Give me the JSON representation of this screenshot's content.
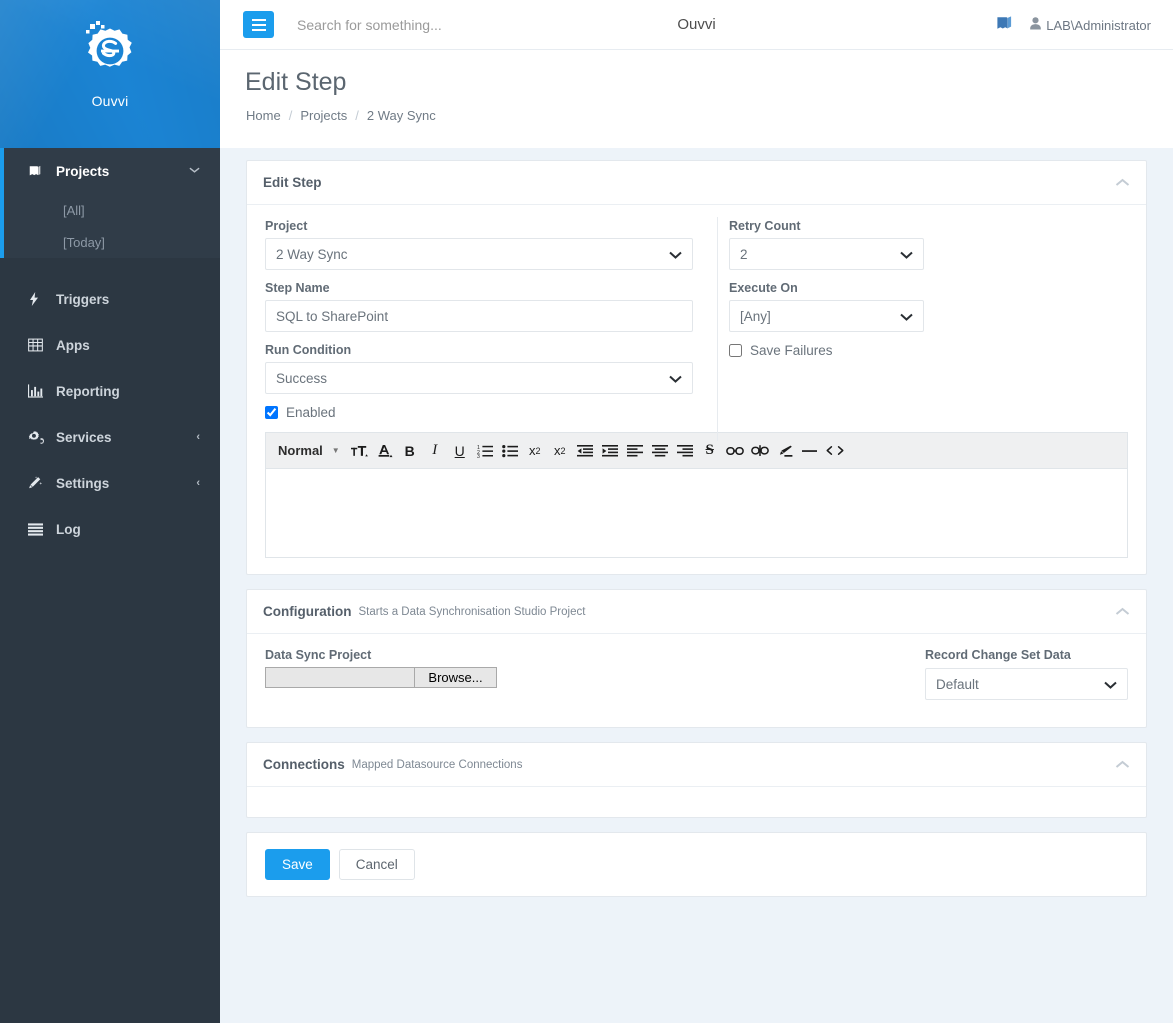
{
  "brand": {
    "name": "Ouvvi"
  },
  "topbar": {
    "title": "Ouvvi",
    "search_placeholder": "Search for something...",
    "search_value": "",
    "user": "LAB\\Administrator"
  },
  "page": {
    "title": "Edit Step",
    "breadcrumb": [
      "Home",
      "Projects",
      "2 Way Sync"
    ]
  },
  "sidebar": {
    "group": {
      "label": "Projects",
      "sub": [
        "[All]",
        "[Today]"
      ]
    },
    "items": [
      {
        "label": "Triggers",
        "icon": "bolt-icon",
        "caret": ""
      },
      {
        "label": "Apps",
        "icon": "table-icon",
        "caret": ""
      },
      {
        "label": "Reporting",
        "icon": "chart-icon",
        "caret": ""
      },
      {
        "label": "Services",
        "icon": "gears-icon",
        "caret": "‹"
      },
      {
        "label": "Settings",
        "icon": "wand-icon",
        "caret": "‹"
      },
      {
        "label": "Log",
        "icon": "list-icon",
        "caret": ""
      }
    ]
  },
  "edit_step": {
    "card_title": "Edit Step",
    "project_label": "Project",
    "project_value": "2 Way Sync",
    "step_name_label": "Step Name",
    "step_name_value": "SQL to SharePoint",
    "run_condition_label": "Run Condition",
    "run_condition_value": "Success",
    "enabled_label": "Enabled",
    "enabled_checked": true,
    "retry_count_label": "Retry Count",
    "retry_count_value": "2",
    "execute_on_label": "Execute On",
    "execute_on_value": "[Any]",
    "save_failures_label": "Save Failures",
    "save_failures_checked": false
  },
  "editor": {
    "style_value": "Normal",
    "content": "",
    "tools": [
      {
        "name": "font-size-icon",
        "glyph": "тT"
      },
      {
        "name": "font-color-icon",
        "glyph": "A"
      },
      {
        "name": "bold-icon",
        "glyph": "B"
      },
      {
        "name": "italic-icon",
        "glyph": "I"
      },
      {
        "name": "underline-icon",
        "glyph": "U"
      },
      {
        "name": "ordered-list-icon",
        "glyph": "1≡"
      },
      {
        "name": "bullet-list-icon",
        "glyph": "☰"
      },
      {
        "name": "subscript-icon",
        "glyph": "x₂"
      },
      {
        "name": "superscript-icon",
        "glyph": "x²"
      },
      {
        "name": "outdent-icon",
        "glyph": "⇤"
      },
      {
        "name": "indent-icon",
        "glyph": "⇥"
      },
      {
        "name": "align-left-icon",
        "glyph": "≡"
      },
      {
        "name": "align-center-icon",
        "glyph": "≡"
      },
      {
        "name": "align-right-icon",
        "glyph": "≡"
      },
      {
        "name": "strikethrough-icon",
        "glyph": "S"
      },
      {
        "name": "link-icon",
        "glyph": "∞"
      },
      {
        "name": "unlink-icon",
        "glyph": "∞"
      },
      {
        "name": "clear-format-icon",
        "glyph": "✎"
      },
      {
        "name": "horizontal-rule-icon",
        "glyph": "—"
      },
      {
        "name": "code-icon",
        "glyph": "</>"
      }
    ]
  },
  "configuration": {
    "title": "Configuration",
    "subtitle": "Starts a Data Synchronisation Studio Project",
    "data_sync_label": "Data Sync Project",
    "browse_label": "Browse...",
    "file_value": "",
    "record_change_label": "Record Change Set Data",
    "record_change_value": "Default"
  },
  "connections": {
    "title": "Connections",
    "subtitle": "Mapped Datasource Connections"
  },
  "actions": {
    "save": "Save",
    "cancel": "Cancel"
  },
  "colors": {
    "accent": "#1b9ded",
    "sidebar": "#2c3742",
    "page_bg": "#edf3f9"
  }
}
